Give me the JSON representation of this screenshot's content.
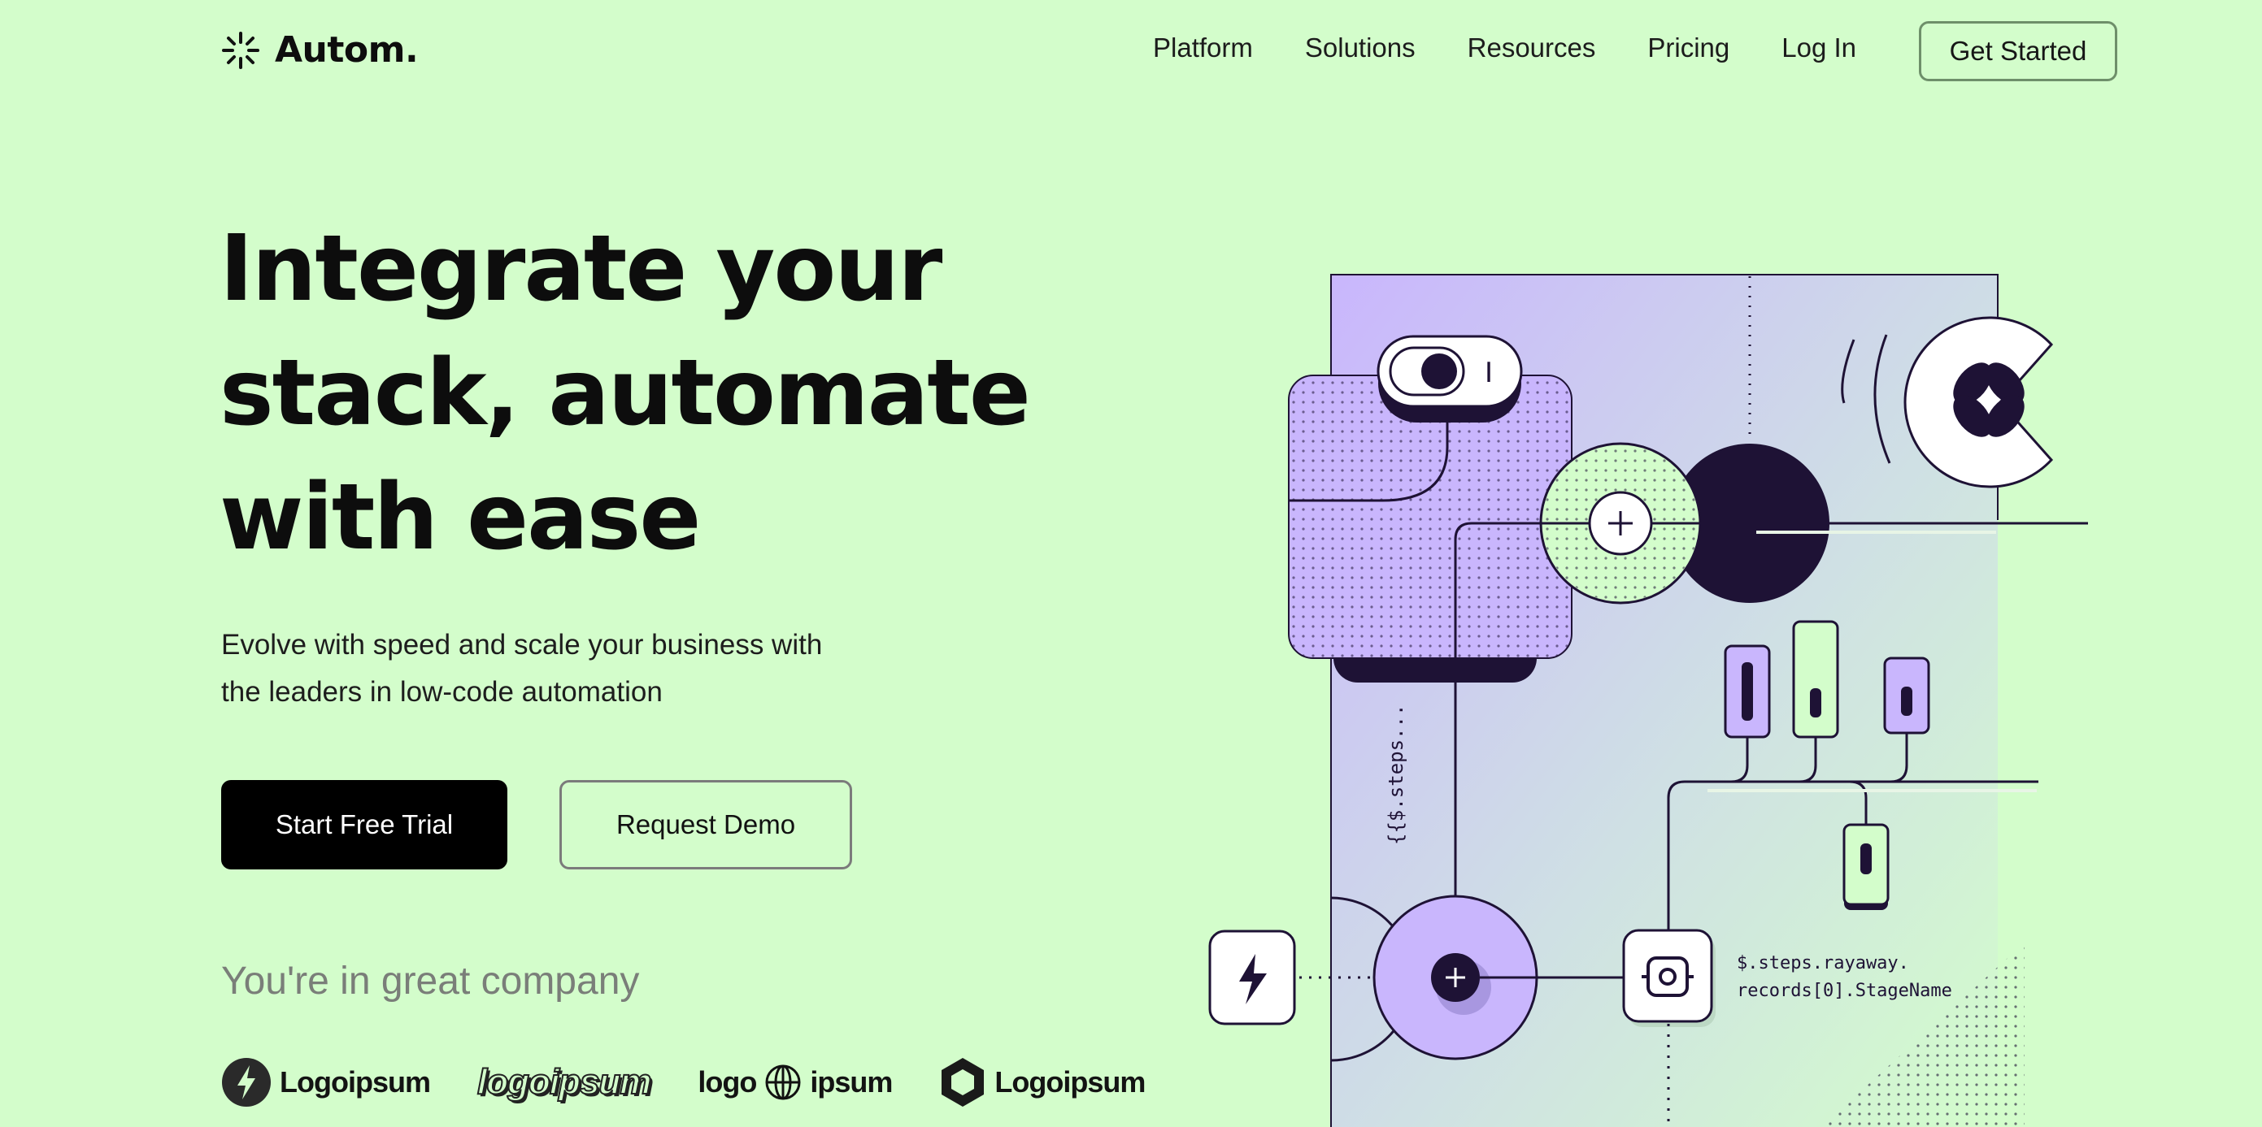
{
  "brand": {
    "name": "Autom.",
    "accent": "#d3fdcb",
    "purple": "#c9b6fd",
    "ink": "#1e1235"
  },
  "nav": {
    "links": [
      "Platform",
      "Solutions",
      "Resources",
      "Pricing",
      "Log In"
    ],
    "cta": "Get Started"
  },
  "hero": {
    "title_lines": [
      "Integrate your",
      "stack, automate",
      "with ease"
    ],
    "subtitle_lines": [
      "Evolve with speed and scale your business with",
      "the leaders in low-code automation"
    ],
    "primary_button": "Start Free Trial",
    "secondary_button": "Request Demo"
  },
  "companies": {
    "heading": "You're in great company",
    "logos": [
      "Logoipsum",
      "logoipsum",
      "logo",
      "ipsum",
      "Logoipsum"
    ]
  },
  "illustration": {
    "code_vertical": "{{$.steps...",
    "code_line1": "$.steps.rayaway.",
    "code_line2": "records[0].StageName",
    "toggle_label": "I"
  }
}
